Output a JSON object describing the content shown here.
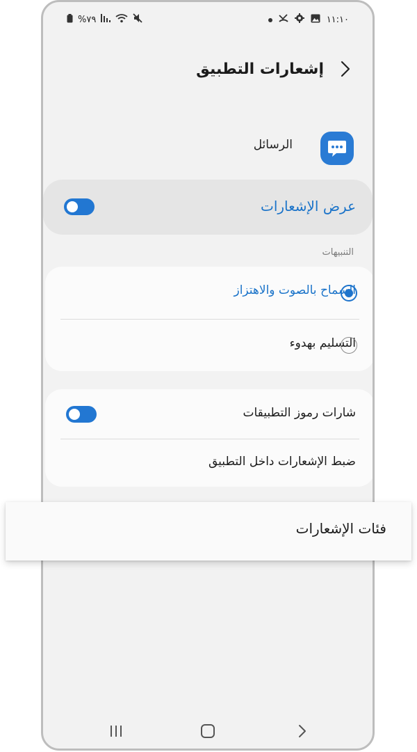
{
  "status_bar": {
    "time": "١١:١٠",
    "battery": "%٧٩",
    "icons": [
      "battery-icon",
      "signal-icon",
      "wifi-icon",
      "mute-icon",
      "dot-icon",
      "missed-call-icon",
      "settings-gear-icon",
      "gallery-icon"
    ]
  },
  "header": {
    "title": "إشعارات التطبيق",
    "back_icon": "chevron-right-icon"
  },
  "app": {
    "name": "الرسائل",
    "icon": "messages-chat-icon",
    "icon_color": "#2a7bd4"
  },
  "show_notifications": {
    "label": "عرض الإشعارات",
    "enabled": true
  },
  "alerts": {
    "section_title": "التنبيهات",
    "options": [
      {
        "label": "السماح بالصوت والاهتزاز",
        "selected": true
      },
      {
        "label": "التسليم بهدوء",
        "selected": false
      }
    ]
  },
  "badges": {
    "label": "شارات رموز التطبيقات",
    "enabled": true
  },
  "in_app": {
    "label": "ضبط الإشعارات داخل التطبيق"
  },
  "categories": {
    "label": "فئات الإشعارات"
  },
  "nav_bar": {
    "icons": [
      "recent-apps-icon",
      "home-icon",
      "back-icon"
    ]
  },
  "colors": {
    "accent": "#1a73c9",
    "toggle_on": "#2277d2",
    "background": "#f2f2f2",
    "card": "#fbfbfb"
  }
}
